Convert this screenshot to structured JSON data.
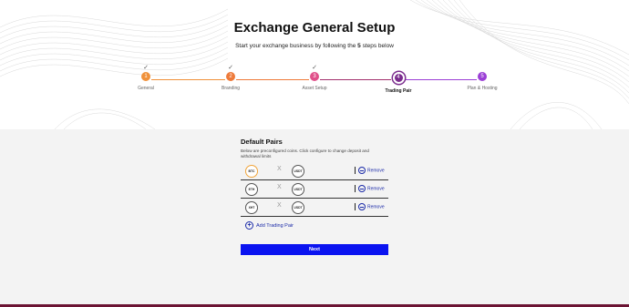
{
  "header": {
    "title": "Exchange General Setup",
    "subtitle_prefix": "Start your exchange business by following the ",
    "subtitle_count": "5",
    "subtitle_suffix": " steps below"
  },
  "steps": [
    {
      "number": "1",
      "label": "General",
      "completed": true,
      "color": "#f0913a"
    },
    {
      "number": "2",
      "label": "Branding",
      "completed": true,
      "color": "#ee7a3a"
    },
    {
      "number": "3",
      "label": "Asset Setup",
      "completed": true,
      "color": "#e0508a"
    },
    {
      "number": "4",
      "label": "Trading Pair",
      "completed": false,
      "active": true,
      "color": "#7b2d8e"
    },
    {
      "number": "5",
      "label": "Plan & Hosting",
      "completed": false,
      "color": "#9b3fd6"
    }
  ],
  "check_glyph": "✓",
  "card": {
    "title": "Default Pairs",
    "description": "Below are preconfigured coins. Click configure to change deposit and withdrawal limits",
    "separator": "X",
    "remove_label": "Remove",
    "pairs": [
      {
        "base": "BTC",
        "quote": "USDT",
        "base_border": "#f0a43a"
      },
      {
        "base": "ETH",
        "quote": "USDT",
        "base_border": "#555555"
      },
      {
        "base": "XHT",
        "quote": "USDT",
        "base_border": "#555555"
      }
    ],
    "add_label": "Add Trading Pair"
  },
  "next_label": "Next",
  "colors": {
    "accent_blue": "#0a13f0",
    "link_blue": "#1a2aa8",
    "background": "#f3f3f3"
  }
}
